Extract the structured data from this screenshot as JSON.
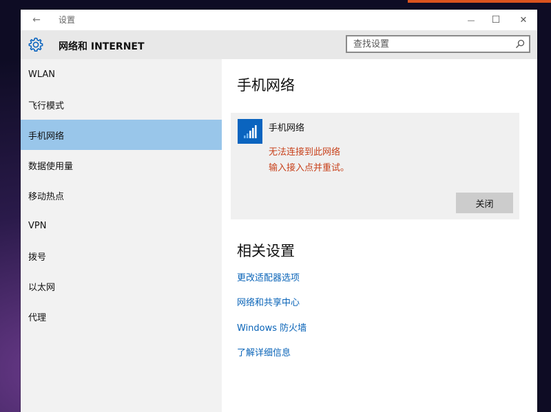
{
  "window": {
    "title": "设置",
    "back_glyph": "←",
    "minimize_glyph": "—",
    "maximize_glyph": "☐",
    "close_glyph": "✕"
  },
  "header": {
    "title": "网络和 INTERNET",
    "search_placeholder": "查找设置"
  },
  "sidebar": {
    "items": [
      {
        "label": "WLAN"
      },
      {
        "label": "飞行模式"
      },
      {
        "label": "手机网络"
      },
      {
        "label": "数据使用量"
      },
      {
        "label": "移动热点"
      },
      {
        "label": "VPN"
      },
      {
        "label": "拨号"
      },
      {
        "label": "以太网"
      },
      {
        "label": "代理"
      }
    ],
    "selected_index": 2
  },
  "main": {
    "title": "手机网络",
    "card": {
      "icon": "cellular-signal-icon",
      "title": "手机网络",
      "error_line1": "无法连接到此网络",
      "error_line2": "输入接入点并重试。",
      "close_label": "关闭"
    },
    "related_title": "相关设置",
    "links": [
      "更改适配器选项",
      "网络和共享中心",
      "Windows 防火墙",
      "了解详细信息"
    ]
  },
  "colors": {
    "accent": "#0a64bf",
    "selected_bg": "#99c6ea",
    "error_text": "#c8421c",
    "link_text": "#0a64b8"
  }
}
